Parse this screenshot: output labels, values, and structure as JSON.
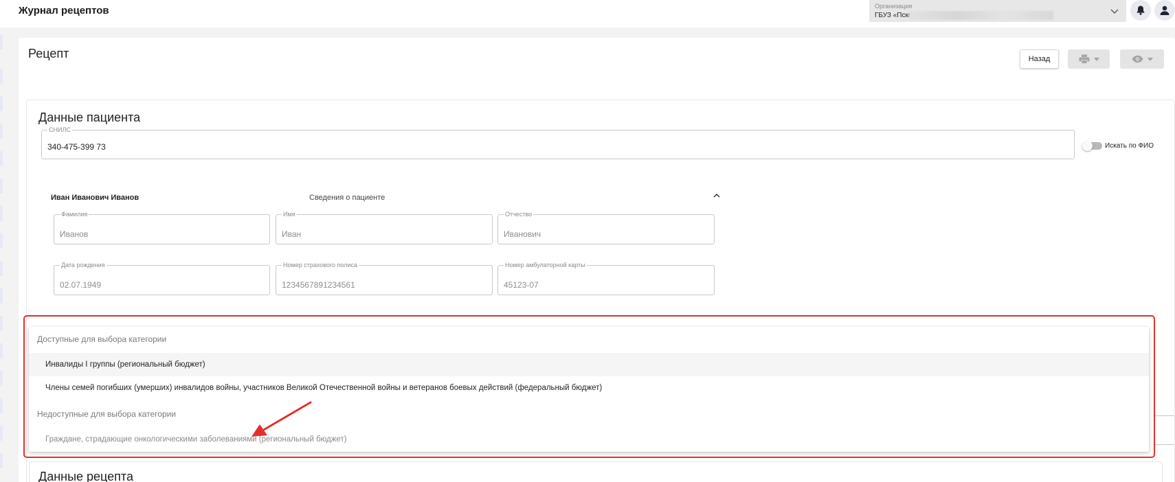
{
  "header": {
    "app_title": "Журнал рецептов",
    "org_label": "Организация",
    "org_value": "ГБУЗ «Пско"
  },
  "icons": {
    "chevron": "chevron-down-icon",
    "bell": "bell-icon",
    "user": "user-icon",
    "print": "printer-icon",
    "eye": "eye-icon",
    "collapse": "chevron-up-icon"
  },
  "card": {
    "title": "Рецепт",
    "back_label": "Назад"
  },
  "patient": {
    "section_title": "Данные пациента",
    "snils_label": "СНИЛС",
    "snils_value": "340-475-399 73",
    "search_by_name_label": "Искать по ФИО",
    "full_name": "Иван Иванович Иванов",
    "info_link": "Сведения о пациенте",
    "fields": {
      "last_name": {
        "label": "Фамилия",
        "value": "Иванов"
      },
      "first_name": {
        "label": "Имя",
        "value": "Иван"
      },
      "middle_name": {
        "label": "Отчество",
        "value": "Иванович"
      },
      "birth_date": {
        "label": "Дата рождения",
        "value": "02.07.1949"
      },
      "policy": {
        "label": "Номер страхового полиса",
        "value": "1234567891234561"
      },
      "card_number": {
        "label": "Номер амбулаторной карты",
        "value": "45123-07"
      }
    }
  },
  "dropdown": {
    "available_header": "Доступные для выбора категории",
    "available_options": [
      "Инвалиды I группы (региональный бюджет)",
      "Члены семей погибших (умерших) инвалидов войны, участников Великой Отечественной войны и ветеранов боевых действий (федеральный бюджет)"
    ],
    "unavailable_header": "Недоступные для выбора категории",
    "unavailable_options": [
      "Граждане, страдающие онкологическими заболеваниями (региональный бюджет)"
    ]
  },
  "recipe_section": {
    "title": "Данные рецепта"
  },
  "colors": {
    "highlight": "#e2302c",
    "header_button_bg": "#e8eaf0",
    "icon_dark": "#1f2430"
  }
}
